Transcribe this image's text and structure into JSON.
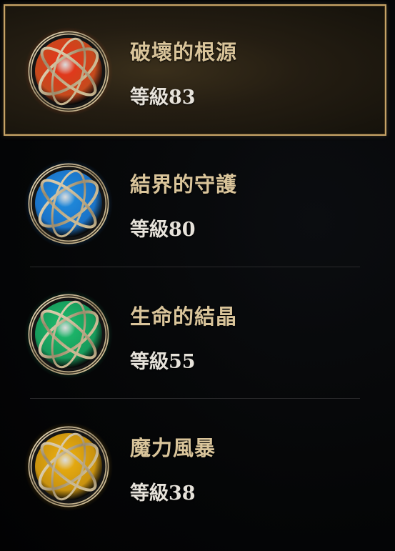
{
  "skills": [
    {
      "name": "破壞的根源",
      "level": "等級83",
      "orb_color": "#e0391c",
      "glow_color": "#c54a1d",
      "icon": "red-fire-orb-icon",
      "selected": true
    },
    {
      "name": "結界的守護",
      "level": "等級80",
      "orb_color": "#1e86d8",
      "glow_color": "#1b73c8",
      "icon": "blue-water-orb-icon",
      "selected": false
    },
    {
      "name": "生命的結晶",
      "level": "等級55",
      "orb_color": "#1cb368",
      "glow_color": "#179a5b",
      "icon": "green-life-orb-icon",
      "selected": false
    },
    {
      "name": "魔力風暴",
      "level": "等級38",
      "orb_color": "#e3a810",
      "glow_color": "#c9920f",
      "icon": "gold-storm-orb-icon",
      "selected": false
    }
  ],
  "colors": {
    "selected_border": "#c6a367",
    "name_text": "#d9c49a",
    "level_text": "#e6e2da",
    "background": "#040405"
  }
}
